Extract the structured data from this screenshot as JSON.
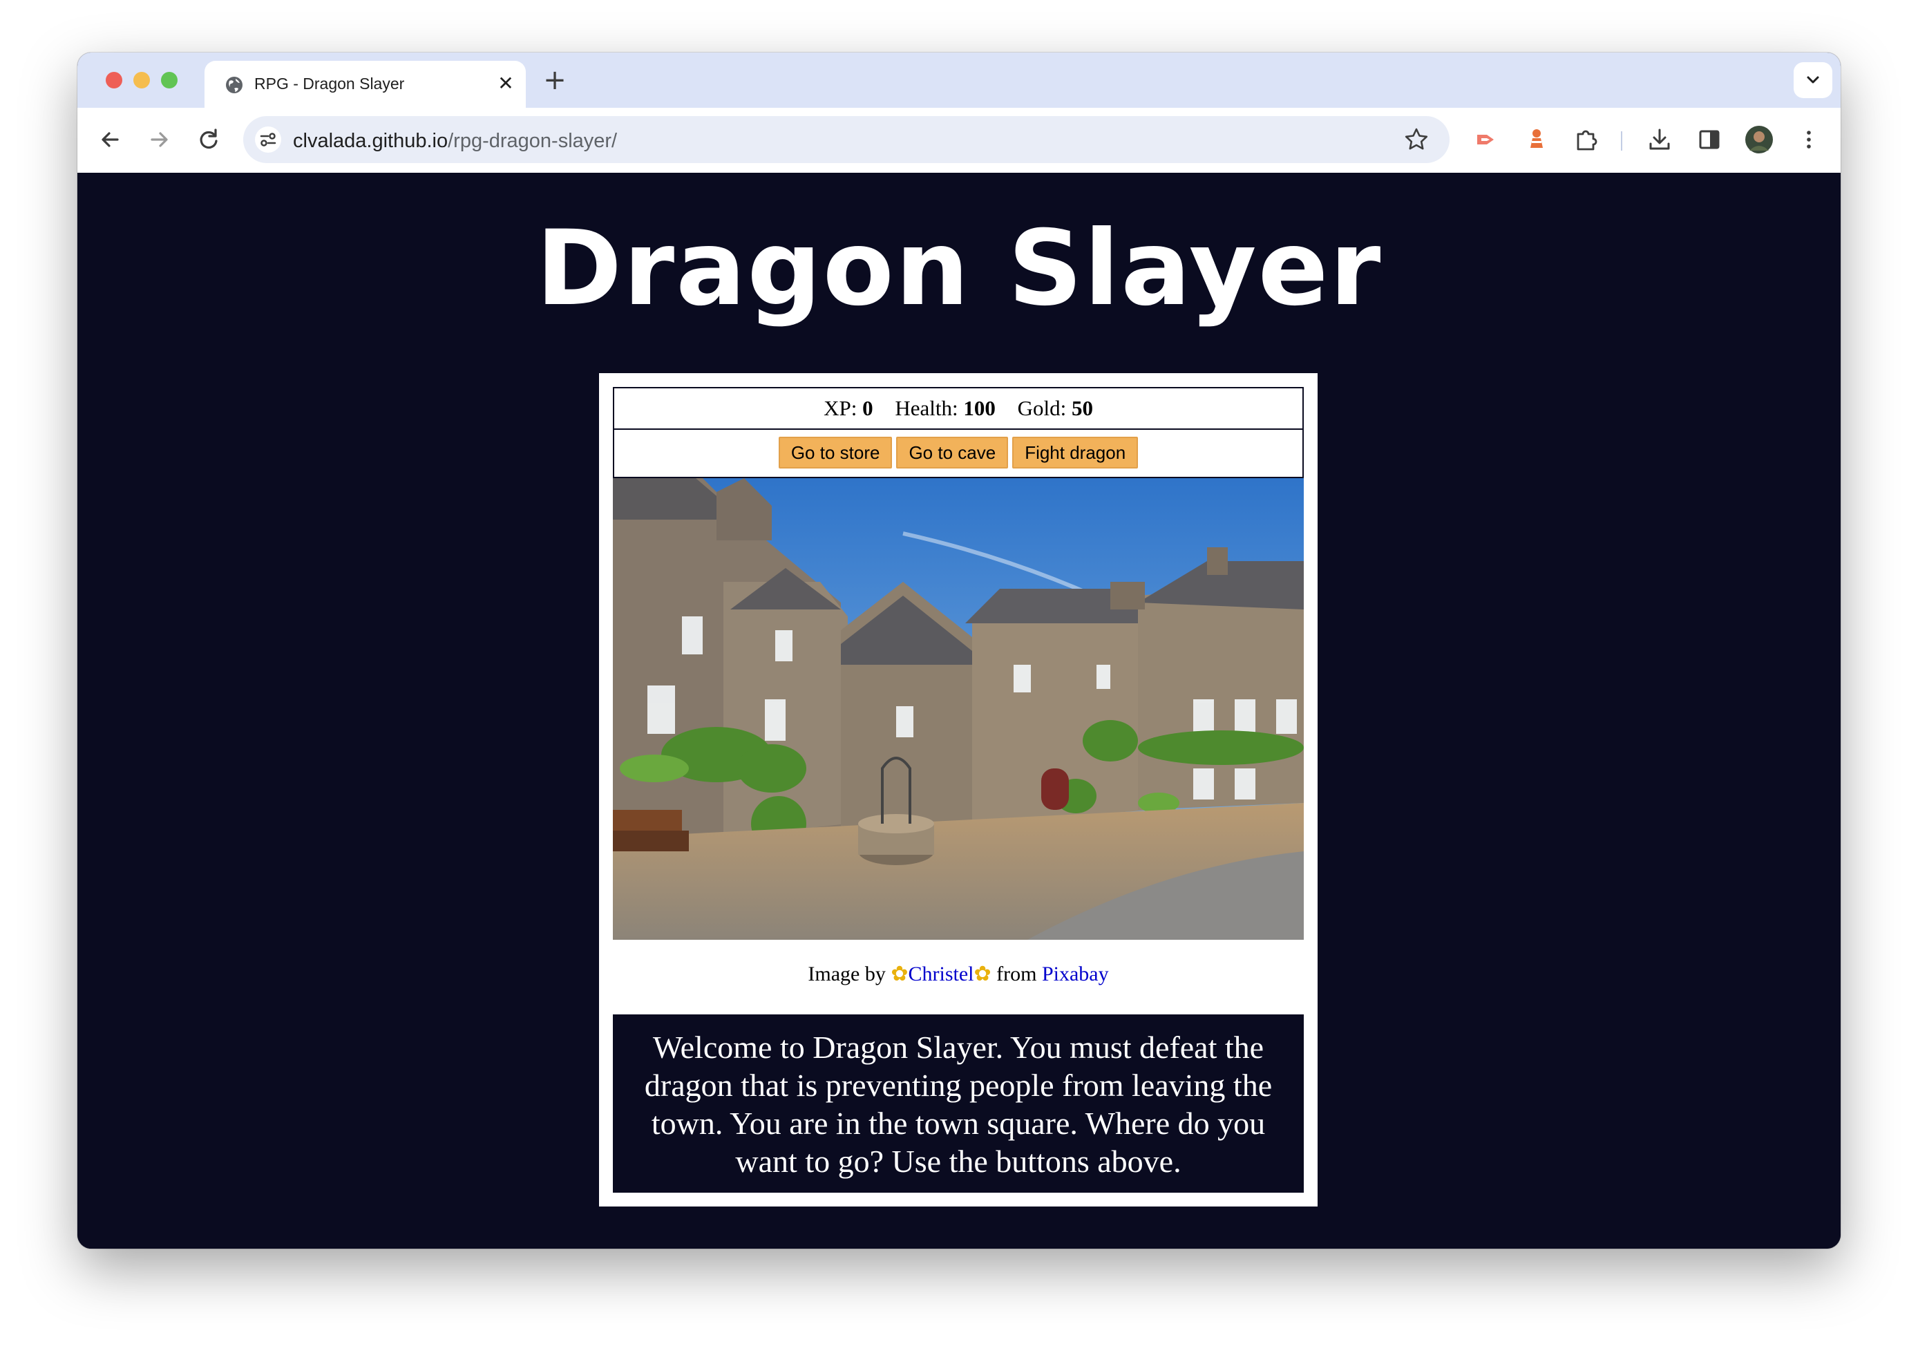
{
  "browser": {
    "tab_title": "RPG - Dragon Slayer",
    "tab_close": "✕",
    "new_tab": "+",
    "url_domain": "clvalada.github.io",
    "url_path": "/rpg-dragon-slayer/"
  },
  "game": {
    "title": "Dragon Slayer",
    "stats": {
      "xp_label": "XP:",
      "xp_value": "0",
      "health_label": "Health:",
      "health_value": "100",
      "gold_label": "Gold:",
      "gold_value": "50"
    },
    "buttons": {
      "button1": "Go to store",
      "button2": "Go to cave",
      "button3": "Fight dragon"
    },
    "credit": {
      "prefix": "Image by",
      "author": "Christel",
      "middle": "from",
      "site": "Pixabay"
    },
    "message": "Welcome to Dragon Slayer. You must defeat the dragon that is preventing people from leaving the town. You are in the town square. Where do you want to go? Use the buttons above."
  },
  "colors": {
    "page_background": "#0a0b20",
    "button_background": "#f2b25a",
    "link": "#0000cc",
    "tab_strip": "#dbe3f7"
  },
  "icons": [
    "globe-icon",
    "close-icon",
    "plus-icon",
    "chevron-down-icon",
    "back-arrow-icon",
    "forward-arrow-icon",
    "reload-icon",
    "site-settings-icon",
    "star-icon",
    "extension-red-icon",
    "extension-orange-icon",
    "puzzle-icon",
    "download-icon",
    "side-panel-icon",
    "avatar",
    "kebab-menu-icon",
    "flower-icon"
  ]
}
